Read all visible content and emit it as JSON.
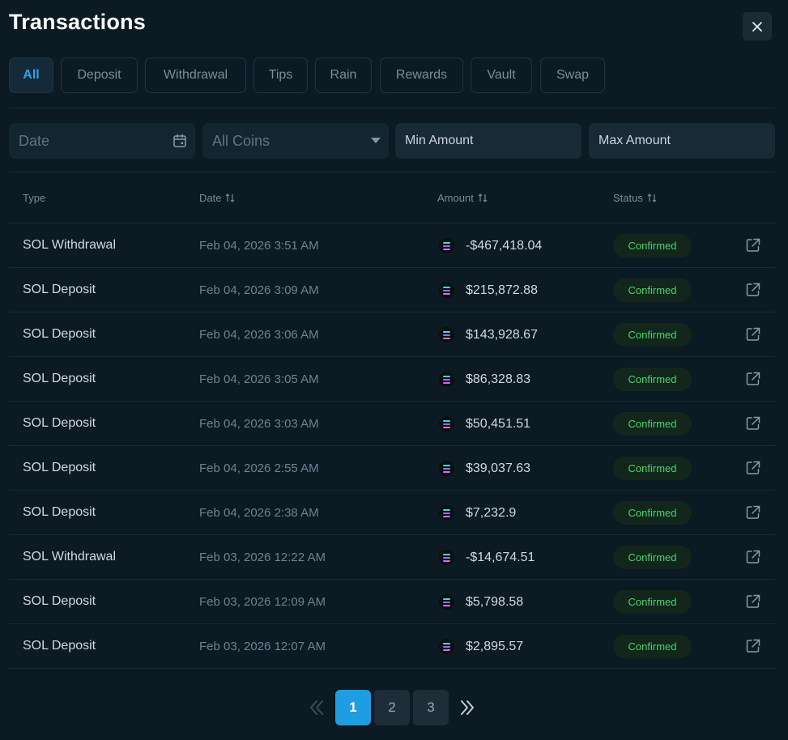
{
  "title": "Transactions",
  "tabs": [
    "All",
    "Deposit",
    "Withdrawal",
    "Tips",
    "Rain",
    "Rewards",
    "Vault",
    "Swap"
  ],
  "active_tab": "All",
  "filters": {
    "date_placeholder": "Date",
    "coin_selected": "All Coins",
    "min_placeholder": "Min Amount",
    "max_placeholder": "Max Amount"
  },
  "columns": [
    "Type",
    "Date",
    "Amount",
    "Status"
  ],
  "rows": [
    {
      "type": "SOL Withdrawal",
      "date": "Feb 04, 2026 3:51 AM",
      "amount": "-$467,418.04",
      "status": "Confirmed"
    },
    {
      "type": "SOL Deposit",
      "date": "Feb 04, 2026 3:09 AM",
      "amount": "$215,872.88",
      "status": "Confirmed"
    },
    {
      "type": "SOL Deposit",
      "date": "Feb 04, 2026 3:06 AM",
      "amount": "$143,928.67",
      "status": "Confirmed"
    },
    {
      "type": "SOL Deposit",
      "date": "Feb 04, 2026 3:05 AM",
      "amount": "$86,328.83",
      "status": "Confirmed"
    },
    {
      "type": "SOL Deposit",
      "date": "Feb 04, 2026 3:03 AM",
      "amount": "$50,451.51",
      "status": "Confirmed"
    },
    {
      "type": "SOL Deposit",
      "date": "Feb 04, 2026 2:55 AM",
      "amount": "$39,037.63",
      "status": "Confirmed"
    },
    {
      "type": "SOL Deposit",
      "date": "Feb 04, 2026 2:38 AM",
      "amount": "$7,232.9",
      "status": "Confirmed"
    },
    {
      "type": "SOL Withdrawal",
      "date": "Feb 03, 2026 12:22 AM",
      "amount": "-$14,674.51",
      "status": "Confirmed"
    },
    {
      "type": "SOL Deposit",
      "date": "Feb 03, 2026 12:09 AM",
      "amount": "$5,798.58",
      "status": "Confirmed"
    },
    {
      "type": "SOL Deposit",
      "date": "Feb 03, 2026 12:07 AM",
      "amount": "$2,895.57",
      "status": "Confirmed"
    }
  ],
  "pagination": {
    "pages": [
      "1",
      "2",
      "3"
    ],
    "current": "1"
  },
  "colors": {
    "accent": "#1e9de1",
    "status_confirmed": "#3fd86a",
    "background": "#0b1a23"
  },
  "icons": {
    "close": "close-icon",
    "calendar": "calendar-icon",
    "dropdown": "chevron-down-icon",
    "sort": "sort-icon",
    "external": "external-link-icon",
    "coin": "solana-icon"
  }
}
